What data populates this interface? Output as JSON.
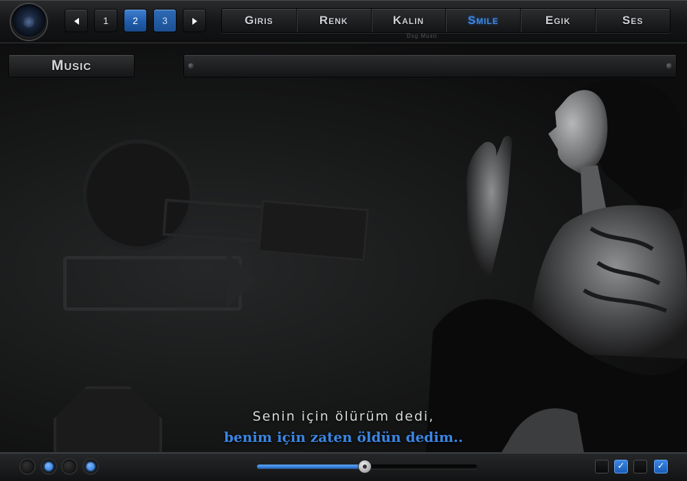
{
  "pager": {
    "prev_icon": "triangle-left",
    "next_icon": "triangle-right",
    "pages": [
      "1",
      "2",
      "3"
    ],
    "active_page": "2"
  },
  "menu": {
    "items": [
      "Giris",
      "Renk",
      "Kalin",
      "Smile",
      "Egik",
      "Ses"
    ],
    "active": "Smile"
  },
  "credit": "Dsg.Musti",
  "section_label": "Music",
  "lyrics": {
    "line1": "Senin için ölürüm dedi,",
    "line2": "benim için zaten öldün dedim.."
  },
  "player": {
    "dots": [
      false,
      true,
      false,
      true
    ],
    "progress": 0.49,
    "checkboxes": [
      false,
      true,
      false,
      true
    ]
  },
  "colors": {
    "accent": "#3a86e3",
    "background": "#0c0c0d"
  }
}
